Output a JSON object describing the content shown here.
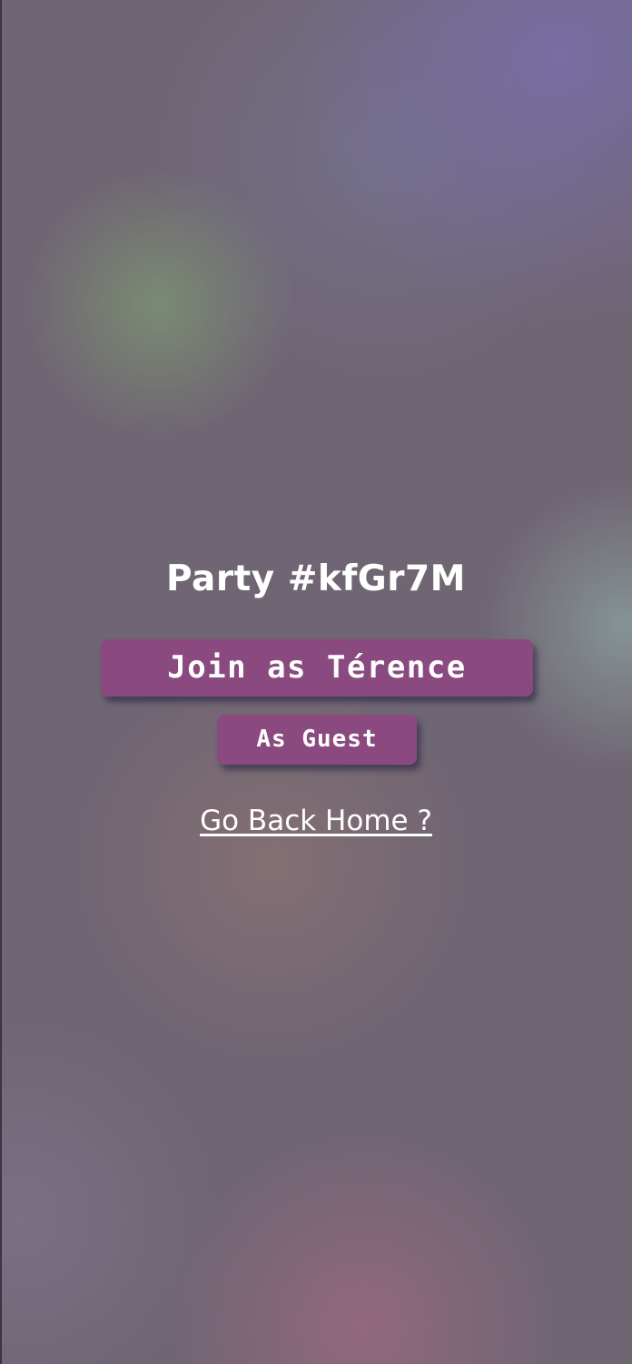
{
  "party": {
    "title": "Party #kfGr7M"
  },
  "actions": {
    "join_label": "Join as Térence",
    "guest_label": "As Guest",
    "home_link_label": "Go Back Home ?"
  },
  "colors": {
    "button_bg": "#8a4a80",
    "text": "#ffffff",
    "background": "#6f6573"
  }
}
